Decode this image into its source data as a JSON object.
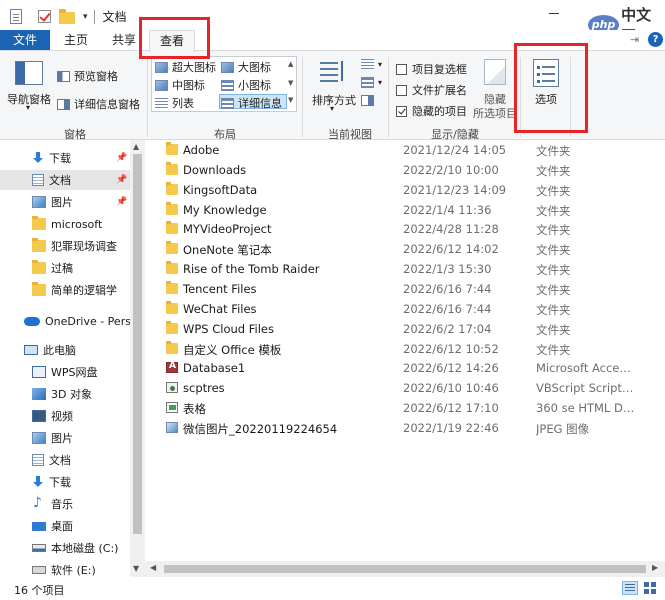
{
  "window": {
    "title": "文档",
    "watermark_logo": "php",
    "watermark_text": "中文网"
  },
  "ribbon_tabs": {
    "file": "文件",
    "home": "主页",
    "share": "共享",
    "view": "查看"
  },
  "ribbon": {
    "panes": {
      "nav_pane": "导航窗格",
      "preview_pane": "预览窗格",
      "details_pane": "详细信息窗格",
      "group": "窗格"
    },
    "layout": {
      "extra_large_icons": "超大图标",
      "large_icons": "大图标",
      "medium_icons": "中图标",
      "small_icons": "小图标",
      "list": "列表",
      "details": "详细信息",
      "group": "布局"
    },
    "current_view": {
      "sort_by": "排序方式",
      "group": "当前视图"
    },
    "show_hide": {
      "item_checkboxes": "项目复选框",
      "item_checkboxes_checked": false,
      "file_extensions": "文件扩展名",
      "file_extensions_checked": false,
      "hidden_items": "隐藏的项目",
      "hidden_items_checked": true,
      "hide_selected_line1": "隐藏",
      "hide_selected_line2": "所选项目",
      "group": "显示/隐藏"
    },
    "options": "选项"
  },
  "nav": {
    "items": [
      {
        "label": "下载",
        "icon": "download-icon",
        "pinned": true
      },
      {
        "label": "文档",
        "icon": "documents-icon",
        "pinned": true,
        "selected": true
      },
      {
        "label": "图片",
        "icon": "pictures-icon",
        "pinned": true
      },
      {
        "label": "microsoft",
        "icon": "folder-icon"
      },
      {
        "label": "犯罪现场调查",
        "icon": "folder-icon"
      },
      {
        "label": "过稿",
        "icon": "folder-icon"
      },
      {
        "label": "简单的逻辑学",
        "icon": "folder-icon"
      },
      {
        "label": "OneDrive - Perso",
        "icon": "onedrive-icon"
      },
      {
        "label": "此电脑",
        "icon": "this-pc-icon"
      },
      {
        "label": "WPS网盘",
        "icon": "wps-drive-icon"
      },
      {
        "label": "3D 对象",
        "icon": "3d-objects-icon"
      },
      {
        "label": "视频",
        "icon": "video-icon"
      },
      {
        "label": "图片",
        "icon": "pictures-icon"
      },
      {
        "label": "文档",
        "icon": "documents-icon"
      },
      {
        "label": "下载",
        "icon": "download-icon"
      },
      {
        "label": "音乐",
        "icon": "music-icon"
      },
      {
        "label": "桌面",
        "icon": "desktop-icon"
      },
      {
        "label": "本地磁盘 (C:)",
        "icon": "local-disk-icon"
      },
      {
        "label": "软件 (E:)",
        "icon": "drive-icon"
      }
    ]
  },
  "files": [
    {
      "name": "Adobe",
      "date": "2021/12/24 14:05",
      "type": "文件夹",
      "icon": "folder"
    },
    {
      "name": "Downloads",
      "date": "2022/2/10 10:00",
      "type": "文件夹",
      "icon": "folder"
    },
    {
      "name": "KingsoftData",
      "date": "2021/12/23 14:09",
      "type": "文件夹",
      "icon": "folder"
    },
    {
      "name": "My Knowledge",
      "date": "2022/1/4 11:36",
      "type": "文件夹",
      "icon": "folder"
    },
    {
      "name": "MYVideoProject",
      "date": "2022/4/28 11:28",
      "type": "文件夹",
      "icon": "folder"
    },
    {
      "name": "OneNote 笔记本",
      "date": "2022/6/12 14:02",
      "type": "文件夹",
      "icon": "folder"
    },
    {
      "name": "Rise of the Tomb Raider",
      "date": "2022/1/3 15:30",
      "type": "文件夹",
      "icon": "folder"
    },
    {
      "name": "Tencent Files",
      "date": "2022/6/16 7:44",
      "type": "文件夹",
      "icon": "folder"
    },
    {
      "name": "WeChat Files",
      "date": "2022/6/16 7:44",
      "type": "文件夹",
      "icon": "folder"
    },
    {
      "name": "WPS Cloud Files",
      "date": "2022/6/2 17:04",
      "type": "文件夹",
      "icon": "folder"
    },
    {
      "name": "自定义 Office 模板",
      "date": "2022/6/12 10:52",
      "type": "文件夹",
      "icon": "folder"
    },
    {
      "name": "Database1",
      "date": "2022/6/12 14:26",
      "type": "Microsoft Acces...",
      "icon": "access"
    },
    {
      "name": "scptres",
      "date": "2022/6/10 10:46",
      "type": "VBScript Script ...",
      "icon": "script"
    },
    {
      "name": "表格",
      "date": "2022/6/12 17:10",
      "type": "360 se HTML Do...",
      "icon": "html"
    },
    {
      "name": "微信图片_20220119224654",
      "date": "2022/1/19 22:46",
      "type": "JPEG 图像",
      "icon": "jpeg"
    }
  ],
  "status": {
    "item_count": "16 个项目"
  },
  "colors": {
    "accent": "#1a63b5",
    "highlight_box": "#e8242b",
    "folder": "#f5c94b"
  }
}
